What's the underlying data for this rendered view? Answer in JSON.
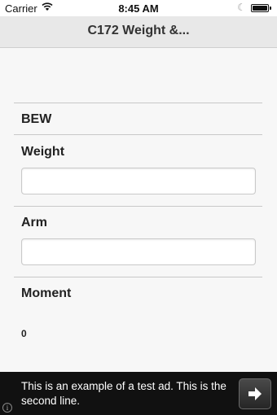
{
  "status_bar": {
    "carrier": "Carrier",
    "time": "8:45 AM",
    "icons": [
      "wifi-icon",
      "moon-icon",
      "battery-icon"
    ]
  },
  "nav": {
    "title": "C172 Weight &..."
  },
  "form": {
    "section_title": "BEW",
    "weight_label": "Weight",
    "weight_value": "",
    "arm_label": "Arm",
    "arm_value": "",
    "moment_label": "Moment",
    "moment_value": "0"
  },
  "ad": {
    "text": "This is an example of a test ad. This is the second line.",
    "action_icon": "arrow-right-icon",
    "info_icon": "info-icon"
  }
}
